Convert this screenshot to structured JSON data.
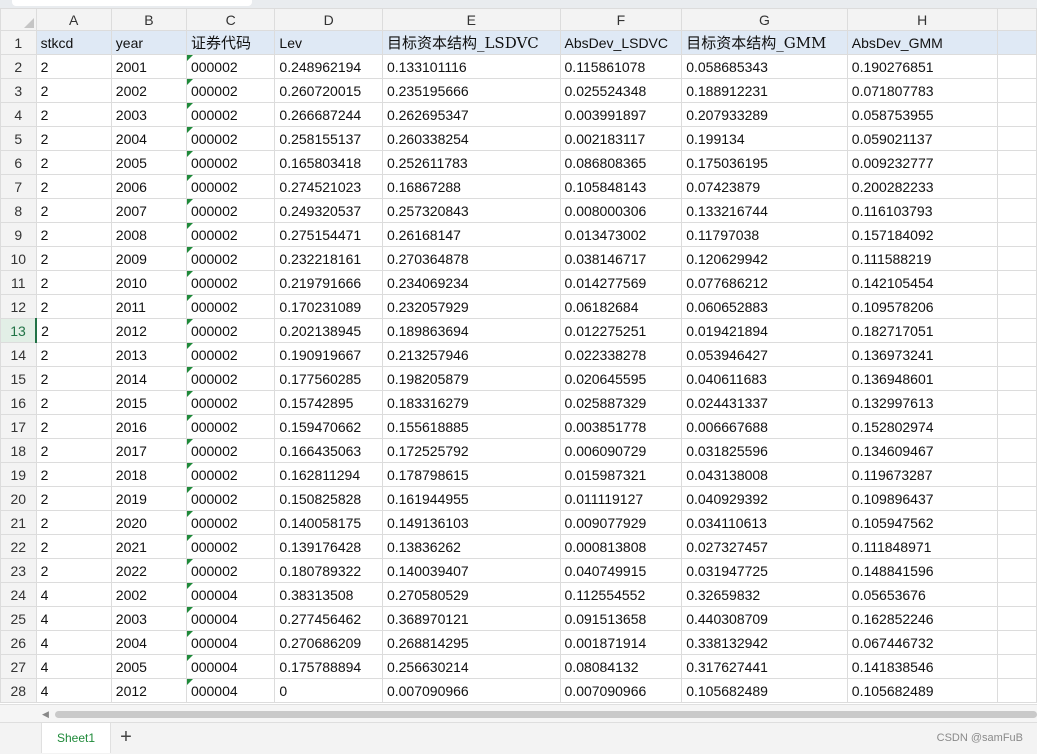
{
  "columns": [
    "A",
    "B",
    "C",
    "D",
    "E",
    "F",
    "G",
    "H"
  ],
  "headers": [
    "stkcd",
    "year",
    "证券代码",
    "Lev",
    "目标资本结构_LSDVC",
    "AbsDev_LSDVC",
    "目标资本结构_GMM",
    "AbsDev_GMM"
  ],
  "rows": [
    [
      "2",
      "2001",
      "000002",
      "0.248962194",
      "0.133101116",
      "0.115861078",
      "0.058685343",
      "0.190276851"
    ],
    [
      "2",
      "2002",
      "000002",
      "0.260720015",
      "0.235195666",
      "0.025524348",
      "0.188912231",
      "0.071807783"
    ],
    [
      "2",
      "2003",
      "000002",
      "0.266687244",
      "0.262695347",
      "0.003991897",
      "0.207933289",
      "0.058753955"
    ],
    [
      "2",
      "2004",
      "000002",
      "0.258155137",
      "0.260338254",
      "0.002183117",
      "0.199134",
      "0.059021137"
    ],
    [
      "2",
      "2005",
      "000002",
      "0.165803418",
      "0.252611783",
      "0.086808365",
      "0.175036195",
      "0.009232777"
    ],
    [
      "2",
      "2006",
      "000002",
      "0.274521023",
      "0.16867288",
      "0.105848143",
      "0.07423879",
      "0.200282233"
    ],
    [
      "2",
      "2007",
      "000002",
      "0.249320537",
      "0.257320843",
      "0.008000306",
      "0.133216744",
      "0.116103793"
    ],
    [
      "2",
      "2008",
      "000002",
      "0.275154471",
      "0.26168147",
      "0.013473002",
      "0.11797038",
      "0.157184092"
    ],
    [
      "2",
      "2009",
      "000002",
      "0.232218161",
      "0.270364878",
      "0.038146717",
      "0.120629942",
      "0.111588219"
    ],
    [
      "2",
      "2010",
      "000002",
      "0.219791666",
      "0.234069234",
      "0.014277569",
      "0.077686212",
      "0.142105454"
    ],
    [
      "2",
      "2011",
      "000002",
      "0.170231089",
      "0.232057929",
      "0.06182684",
      "0.060652883",
      "0.109578206"
    ],
    [
      "2",
      "2012",
      "000002",
      "0.202138945",
      "0.189863694",
      "0.012275251",
      "0.019421894",
      "0.182717051"
    ],
    [
      "2",
      "2013",
      "000002",
      "0.190919667",
      "0.213257946",
      "0.022338278",
      "0.053946427",
      "0.136973241"
    ],
    [
      "2",
      "2014",
      "000002",
      "0.177560285",
      "0.198205879",
      "0.020645595",
      "0.040611683",
      "0.136948601"
    ],
    [
      "2",
      "2015",
      "000002",
      "0.15742895",
      "0.183316279",
      "0.025887329",
      "0.024431337",
      "0.132997613"
    ],
    [
      "2",
      "2016",
      "000002",
      "0.159470662",
      "0.155618885",
      "0.003851778",
      "0.006667688",
      "0.152802974"
    ],
    [
      "2",
      "2017",
      "000002",
      "0.166435063",
      "0.172525792",
      "0.006090729",
      "0.031825596",
      "0.134609467"
    ],
    [
      "2",
      "2018",
      "000002",
      "0.162811294",
      "0.178798615",
      "0.015987321",
      "0.043138008",
      "0.119673287"
    ],
    [
      "2",
      "2019",
      "000002",
      "0.150825828",
      "0.161944955",
      "0.011119127",
      "0.040929392",
      "0.109896437"
    ],
    [
      "2",
      "2020",
      "000002",
      "0.140058175",
      "0.149136103",
      "0.009077929",
      "0.034110613",
      "0.105947562"
    ],
    [
      "2",
      "2021",
      "000002",
      "0.139176428",
      "0.13836262",
      "0.000813808",
      "0.027327457",
      "0.111848971"
    ],
    [
      "2",
      "2022",
      "000002",
      "0.180789322",
      "0.140039407",
      "0.040749915",
      "0.031947725",
      "0.148841596"
    ],
    [
      "4",
      "2002",
      "000004",
      "0.38313508",
      "0.270580529",
      "0.112554552",
      "0.32659832",
      "0.05653676"
    ],
    [
      "4",
      "2003",
      "000004",
      "0.277456462",
      "0.368970121",
      "0.091513658",
      "0.440308709",
      "0.162852246"
    ],
    [
      "4",
      "2004",
      "000004",
      "0.270686209",
      "0.268814295",
      "0.001871914",
      "0.338132942",
      "0.067446732"
    ],
    [
      "4",
      "2005",
      "000004",
      "0.175788894",
      "0.256630214",
      "0.08084132",
      "0.317627441",
      "0.141838546"
    ],
    [
      "4",
      "2012",
      "000004",
      "0",
      "0.007090966",
      "0.007090966",
      "0.105682489",
      "0.105682489"
    ]
  ],
  "active_row": "13",
  "sheet_tab": "Sheet1",
  "add_sheet": "+",
  "watermark": "CSDN @samFuB",
  "colors": {
    "accent": "#217346",
    "header_fill": "#dfe9f5",
    "marker": "#1f8a3a"
  }
}
